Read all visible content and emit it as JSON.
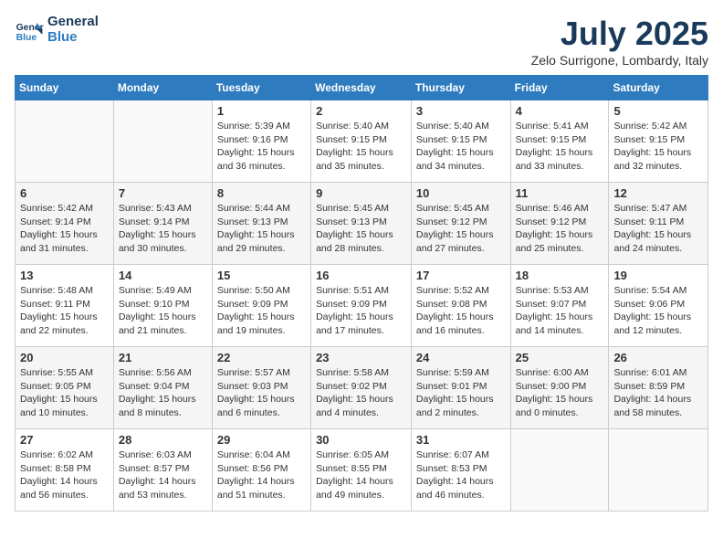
{
  "header": {
    "logo_line1": "General",
    "logo_line2": "Blue",
    "month": "July 2025",
    "location": "Zelo Surrigone, Lombardy, Italy"
  },
  "columns": [
    "Sunday",
    "Monday",
    "Tuesday",
    "Wednesday",
    "Thursday",
    "Friday",
    "Saturday"
  ],
  "weeks": [
    [
      {
        "day": "",
        "content": ""
      },
      {
        "day": "",
        "content": ""
      },
      {
        "day": "1",
        "content": "Sunrise: 5:39 AM\nSunset: 9:16 PM\nDaylight: 15 hours\nand 36 minutes."
      },
      {
        "day": "2",
        "content": "Sunrise: 5:40 AM\nSunset: 9:15 PM\nDaylight: 15 hours\nand 35 minutes."
      },
      {
        "day": "3",
        "content": "Sunrise: 5:40 AM\nSunset: 9:15 PM\nDaylight: 15 hours\nand 34 minutes."
      },
      {
        "day": "4",
        "content": "Sunrise: 5:41 AM\nSunset: 9:15 PM\nDaylight: 15 hours\nand 33 minutes."
      },
      {
        "day": "5",
        "content": "Sunrise: 5:42 AM\nSunset: 9:15 PM\nDaylight: 15 hours\nand 32 minutes."
      }
    ],
    [
      {
        "day": "6",
        "content": "Sunrise: 5:42 AM\nSunset: 9:14 PM\nDaylight: 15 hours\nand 31 minutes."
      },
      {
        "day": "7",
        "content": "Sunrise: 5:43 AM\nSunset: 9:14 PM\nDaylight: 15 hours\nand 30 minutes."
      },
      {
        "day": "8",
        "content": "Sunrise: 5:44 AM\nSunset: 9:13 PM\nDaylight: 15 hours\nand 29 minutes."
      },
      {
        "day": "9",
        "content": "Sunrise: 5:45 AM\nSunset: 9:13 PM\nDaylight: 15 hours\nand 28 minutes."
      },
      {
        "day": "10",
        "content": "Sunrise: 5:45 AM\nSunset: 9:12 PM\nDaylight: 15 hours\nand 27 minutes."
      },
      {
        "day": "11",
        "content": "Sunrise: 5:46 AM\nSunset: 9:12 PM\nDaylight: 15 hours\nand 25 minutes."
      },
      {
        "day": "12",
        "content": "Sunrise: 5:47 AM\nSunset: 9:11 PM\nDaylight: 15 hours\nand 24 minutes."
      }
    ],
    [
      {
        "day": "13",
        "content": "Sunrise: 5:48 AM\nSunset: 9:11 PM\nDaylight: 15 hours\nand 22 minutes."
      },
      {
        "day": "14",
        "content": "Sunrise: 5:49 AM\nSunset: 9:10 PM\nDaylight: 15 hours\nand 21 minutes."
      },
      {
        "day": "15",
        "content": "Sunrise: 5:50 AM\nSunset: 9:09 PM\nDaylight: 15 hours\nand 19 minutes."
      },
      {
        "day": "16",
        "content": "Sunrise: 5:51 AM\nSunset: 9:09 PM\nDaylight: 15 hours\nand 17 minutes."
      },
      {
        "day": "17",
        "content": "Sunrise: 5:52 AM\nSunset: 9:08 PM\nDaylight: 15 hours\nand 16 minutes."
      },
      {
        "day": "18",
        "content": "Sunrise: 5:53 AM\nSunset: 9:07 PM\nDaylight: 15 hours\nand 14 minutes."
      },
      {
        "day": "19",
        "content": "Sunrise: 5:54 AM\nSunset: 9:06 PM\nDaylight: 15 hours\nand 12 minutes."
      }
    ],
    [
      {
        "day": "20",
        "content": "Sunrise: 5:55 AM\nSunset: 9:05 PM\nDaylight: 15 hours\nand 10 minutes."
      },
      {
        "day": "21",
        "content": "Sunrise: 5:56 AM\nSunset: 9:04 PM\nDaylight: 15 hours\nand 8 minutes."
      },
      {
        "day": "22",
        "content": "Sunrise: 5:57 AM\nSunset: 9:03 PM\nDaylight: 15 hours\nand 6 minutes."
      },
      {
        "day": "23",
        "content": "Sunrise: 5:58 AM\nSunset: 9:02 PM\nDaylight: 15 hours\nand 4 minutes."
      },
      {
        "day": "24",
        "content": "Sunrise: 5:59 AM\nSunset: 9:01 PM\nDaylight: 15 hours\nand 2 minutes."
      },
      {
        "day": "25",
        "content": "Sunrise: 6:00 AM\nSunset: 9:00 PM\nDaylight: 15 hours\nand 0 minutes."
      },
      {
        "day": "26",
        "content": "Sunrise: 6:01 AM\nSunset: 8:59 PM\nDaylight: 14 hours\nand 58 minutes."
      }
    ],
    [
      {
        "day": "27",
        "content": "Sunrise: 6:02 AM\nSunset: 8:58 PM\nDaylight: 14 hours\nand 56 minutes."
      },
      {
        "day": "28",
        "content": "Sunrise: 6:03 AM\nSunset: 8:57 PM\nDaylight: 14 hours\nand 53 minutes."
      },
      {
        "day": "29",
        "content": "Sunrise: 6:04 AM\nSunset: 8:56 PM\nDaylight: 14 hours\nand 51 minutes."
      },
      {
        "day": "30",
        "content": "Sunrise: 6:05 AM\nSunset: 8:55 PM\nDaylight: 14 hours\nand 49 minutes."
      },
      {
        "day": "31",
        "content": "Sunrise: 6:07 AM\nSunset: 8:53 PM\nDaylight: 14 hours\nand 46 minutes."
      },
      {
        "day": "",
        "content": ""
      },
      {
        "day": "",
        "content": ""
      }
    ]
  ]
}
